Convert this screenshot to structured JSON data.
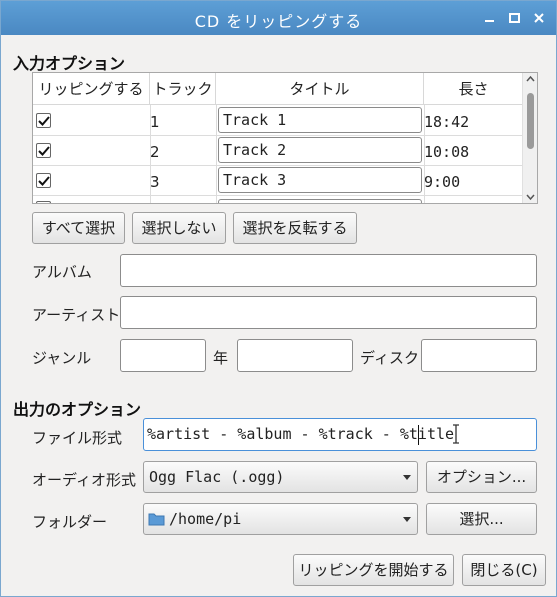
{
  "window": {
    "title": "CD をリッピングする"
  },
  "input_options": {
    "title": "入力オプション",
    "columns": [
      "リッピングする",
      "トラック",
      "タイトル",
      "長さ"
    ],
    "rows": [
      {
        "rip": true,
        "track": "1",
        "title": "Track 1",
        "length": "18:42"
      },
      {
        "rip": true,
        "track": "2",
        "title": "Track 2",
        "length": "10:08"
      },
      {
        "rip": true,
        "track": "3",
        "title": "Track 3",
        "length": "9:00"
      }
    ],
    "buttons": {
      "select_all": "すべて選択",
      "select_none": "選択しない",
      "invert": "選択を反転する"
    },
    "album_label": "アルバム",
    "album_value": "",
    "artist_label": "アーティスト",
    "artist_value": "",
    "genre_label": "ジャンル",
    "genre_value": "",
    "year_label": "年",
    "year_value": "",
    "disc_label": "ディスク",
    "disc_value": ""
  },
  "output_options": {
    "title": "出力のオプション",
    "file_format_label": "ファイル形式",
    "file_format_value": "%artist - %album - %track - %title",
    "audio_format_label": "オーディオ形式",
    "audio_format_value": "Ogg Flac (.ogg)",
    "options_button": "オプション...",
    "folder_label": "フォルダー",
    "folder_value": "/home/pi",
    "browse_button": "選択..."
  },
  "actions": {
    "start": "リッピングを開始する",
    "close": "閉じる(C)"
  },
  "colors": {
    "titlebar": "#4a88c2",
    "focus": "#4a90d9",
    "folder_icon": "#5a9ad6"
  },
  "icons": [
    "minimize-icon",
    "maximize-icon",
    "close-icon",
    "check-icon",
    "folder-icon",
    "text-cursor-icon",
    "chevron-down-icon"
  ]
}
